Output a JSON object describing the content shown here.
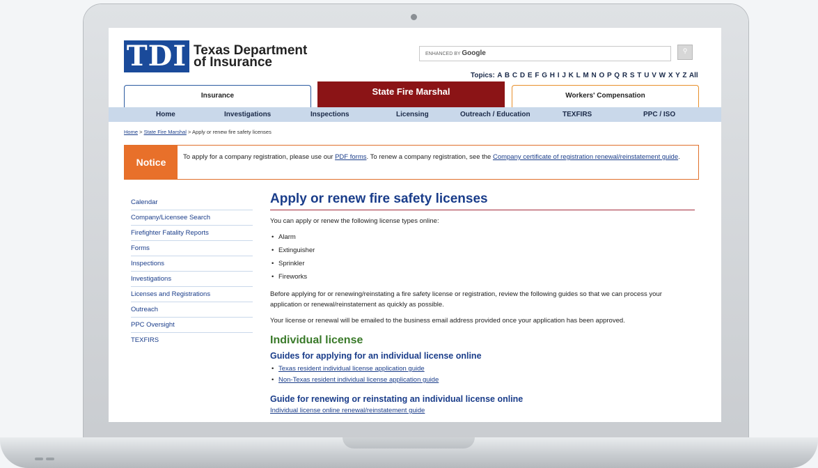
{
  "header": {
    "logo_mark": "TDI",
    "logo_line1": "Texas Department",
    "logo_line2": "of Insurance",
    "search_brand_prefix": "ENHANCED BY",
    "search_brand_name": "Google",
    "topics_label": "Topics:",
    "topics_letters": "A B C D E F G H I J K L M N O P Q R S T U V W X Y Z  All"
  },
  "program_tabs": {
    "insurance": "Insurance",
    "state_fire_marshal": "State Fire Marshal",
    "workers_comp": "Workers' Compensation"
  },
  "nav": [
    "Home",
    "Investigations",
    "Inspections",
    "Licensing",
    "Outreach / Education",
    "TEXFIRS",
    "PPC / ISO"
  ],
  "breadcrumb": {
    "home": "Home",
    "sep": ">",
    "section": "State Fire Marshal",
    "current": "Apply or renew fire safety licenses"
  },
  "notice": {
    "label": "Notice",
    "text1": "To apply for a company registration, please use our ",
    "link1": "PDF forms",
    "text2": ". To renew a company registration, see the ",
    "link2": "Company certificate of registration renewal/reinstatement guide",
    "text3": "."
  },
  "sidebar": [
    "Calendar",
    "Company/Licensee Search",
    "Firefighter Fatality Reports",
    "Forms",
    "Inspections",
    "Investigations",
    "Licenses and Registrations",
    "Outreach",
    "PPC Oversight",
    "TEXFIRS"
  ],
  "main": {
    "title": "Apply or renew fire safety licenses",
    "intro": "You can apply or renew the following license types online:",
    "license_types": [
      "Alarm",
      "Extinguisher",
      "Sprinkler",
      "Fireworks"
    ],
    "para2": "Before applying for or renewing/reinstating a fire safety license or registration, review the following guides so that we can process your application or renewal/reinstatement as quickly as possible.",
    "para3": "Your license or renewal will be emailed to the business email address provided once your application has been approved.",
    "section_title": "Individual license",
    "sub1": "Guides for applying for an individual license online",
    "apply_guides": [
      "Texas resident individual license application guide",
      "Non-Texas resident individual license application guide"
    ],
    "sub2": "Guide for renewing or reinstating an individual license online",
    "renew_link": "Individual license online renewal/reinstatement guide"
  },
  "colors": {
    "brand_blue": "#1a4a9a",
    "sfm_red": "#8b1416",
    "notice_orange": "#e8702a",
    "nav_bg": "#c9d8ea",
    "heading_green": "#3a7a2a"
  }
}
